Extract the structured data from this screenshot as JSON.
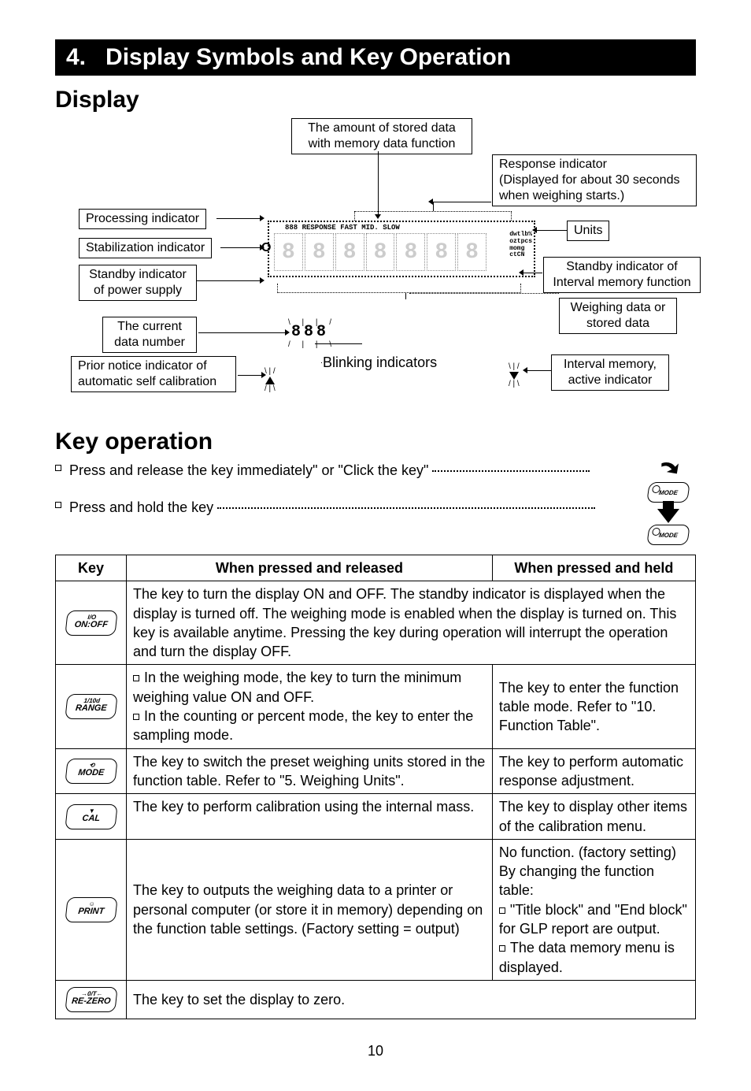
{
  "banner": {
    "num": "4.",
    "title": "Display Symbols and Key Operation"
  },
  "section": {
    "display": "Display",
    "keyop": "Key operation"
  },
  "diagram": {
    "stored_data": "The amount of stored data\nwith memory data function",
    "response": "Response indicator\n(Displayed for about 30 seconds\nwhen weighing starts.)",
    "processing": "Processing indicator",
    "stabilization": "Stabilization indicator",
    "standby_power": "Standby indicator\nof power supply",
    "units": "Units",
    "standby_interval": "Standby indicator of\nInterval memory function",
    "weighing_data": "Weighing data or\nstored data",
    "current_num": "The current\ndata number",
    "prior_notice": "Prior notice indicator of\nautomatic self calibration",
    "blinking": "Blinking indicators",
    "interval_active": "Interval memory,\nactive indicator",
    "lcd_top": "888 RESPONSE FAST MID. SLOW",
    "lcd_units": "dwtlb%\noztpcs\nmomg\nctCN",
    "n888": "888"
  },
  "keyop": {
    "press_release": "Press and release the key immediately\" or \"Click the key\"",
    "press_hold": "Press and hold the key",
    "mode_label": "MODE"
  },
  "table": {
    "headers": {
      "key": "Key",
      "pressed": "When pressed and released",
      "held": "When pressed and held"
    },
    "r1": {
      "key_top": "I/O",
      "key_main": "ON:OFF",
      "span": "The key to turn the display ON and OFF. The standby indicator is displayed when the display is turned off. The weighing mode is enabled when the display is turned on. This key is available anytime. Pressing the key during operation will interrupt the operation and turn the display OFF."
    },
    "r2": {
      "key_top": "1/10d",
      "key_main": "RANGE",
      "p_a": "In the weighing mode, the key to turn the minimum weighing value ON and OFF.",
      "p_b": "In the counting or percent mode, the key to enter the sampling mode.",
      "held": "The key to enter the function table mode. Refer to \"10. Function Table\"."
    },
    "r3": {
      "key_top": "⟲",
      "key_main": "MODE",
      "p": "The key to switch the preset weighing units stored in the function table. Refer to \"5. Weighing Units\".",
      "held": "The key to perform automatic response adjustment."
    },
    "r4": {
      "key_top": "▼",
      "key_main": "CAL",
      "p": "The key to perform calibration using the internal mass.",
      "held": "The key to display other items of the calibration menu."
    },
    "r5": {
      "key_top": "☺",
      "key_main": "PRINT",
      "p": "The key to outputs the weighing data to a printer or personal computer (or store it in memory) depending on the function table settings.      (Factory setting = output)",
      "h_a": "No function. (factory setting)",
      "h_b": "By changing the function table:",
      "h_c": "\"Title block\" and \"End block\" for GLP report are output.",
      "h_d": "The data memory menu is displayed."
    },
    "r6": {
      "key_top": "→0/T←",
      "key_main": "RE-ZERO",
      "p": "The key to set the display to zero."
    }
  },
  "page_number": "10"
}
